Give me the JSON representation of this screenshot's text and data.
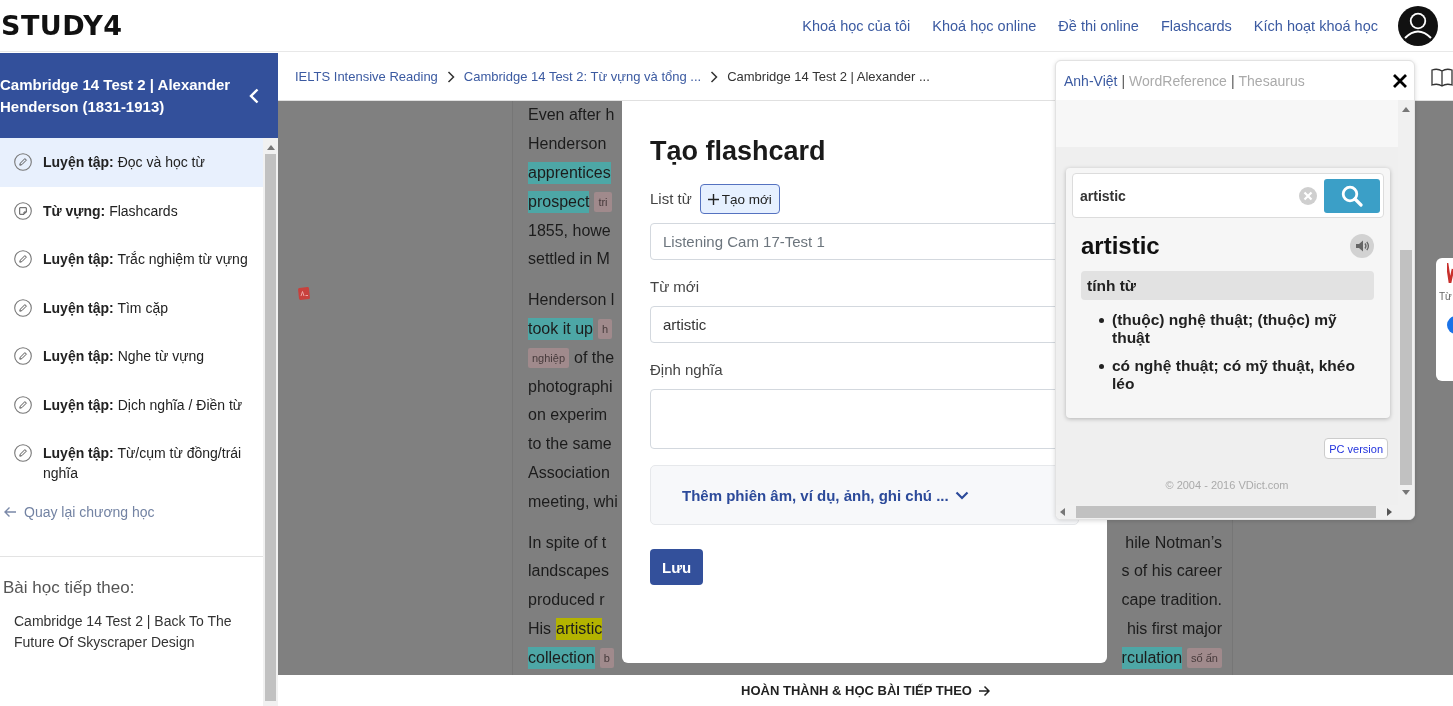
{
  "header": {
    "logo": "STUDY4",
    "nav": [
      {
        "label": "Khoá học của tôi"
      },
      {
        "label": "Khoá học online"
      },
      {
        "label": "Đề thi online"
      },
      {
        "label": "Flashcards"
      },
      {
        "label": "Kích hoạt khoá học"
      }
    ]
  },
  "sidebar": {
    "title": "Cambridge 14 Test 2 | Alexander Henderson (1831-1913)",
    "items": [
      {
        "kind": "exercise",
        "text": "**Luyện tập:** Đọc và học từ",
        "selected": true
      },
      {
        "kind": "flashcard",
        "text": "**Từ vựng:** Flashcards",
        "selected": false
      },
      {
        "kind": "exercise",
        "text": "**Luyện tập:** Trắc nghiệm từ vựng",
        "selected": false
      },
      {
        "kind": "exercise",
        "text": "**Luyện tập:** Tìm cặp",
        "selected": false
      },
      {
        "kind": "exercise",
        "text": "**Luyện tập:** Nghe từ vựng",
        "selected": false
      },
      {
        "kind": "exercise",
        "text": "**Luyện tập:** Dịch nghĩa / Điền từ",
        "selected": false
      },
      {
        "kind": "exercise",
        "text": "**Luyện tập:** Từ/cụm từ đồng/trái nghĩa",
        "selected": false
      }
    ],
    "back_link": "Quay lại chương học",
    "next_heading": "Bài học tiếp theo:",
    "next_lesson": "Cambridge 14 Test 2 | Back To The Future Of Skyscraper Design"
  },
  "breadcrumb": [
    {
      "label": "IELTS Intensive Reading",
      "current": false
    },
    {
      "label": "Cambridge 14 Test 2: Từ vựng và tổng ...",
      "current": false
    },
    {
      "label": "Cambridge 14 Test 2 | Alexander ...",
      "current": true
    }
  ],
  "article": {
    "paragraphs": [
      {
        "lines": [
          {
            "left": [
              {
                "kind": "text",
                "text": "Even after h"
              }
            ]
          },
          {
            "left": [
              {
                "kind": "text",
                "text": "Henderson"
              }
            ]
          },
          {
            "left": [
              {
                "kind": "vocab",
                "text": "apprentices"
              }
            ]
          },
          {
            "left": [
              {
                "kind": "vocab",
                "text": "prospect"
              },
              {
                "kind": "gloss",
                "text": "tri"
              }
            ]
          },
          {
            "left": [
              {
                "kind": "text",
                "text": "1855, howe"
              }
            ]
          },
          {
            "left": [
              {
                "kind": "text",
                "text": "settled in M"
              }
            ]
          }
        ]
      },
      {
        "lines": [
          {
            "left": [
              {
                "kind": "text",
                "text": "Henderson l"
              }
            ]
          },
          {
            "left": [
              {
                "kind": "vocab",
                "text": "took it up"
              },
              {
                "kind": "gloss",
                "text": "h"
              }
            ]
          },
          {
            "left": [
              {
                "kind": "gloss",
                "text": "nghiệp"
              },
              {
                "kind": "text",
                "text": "of the"
              }
            ]
          },
          {
            "left": [
              {
                "kind": "text",
                "text": "photographi"
              }
            ]
          },
          {
            "left": [
              {
                "kind": "text",
                "text": "on experim"
              }
            ]
          },
          {
            "left": [
              {
                "kind": "text",
                "text": "to the same"
              }
            ]
          },
          {
            "left": [
              {
                "kind": "text",
                "text": "Association"
              }
            ]
          },
          {
            "left": [
              {
                "kind": "text",
                "text": "meeting, whi"
              }
            ]
          }
        ]
      },
      {
        "lines": [
          {
            "left": [
              {
                "kind": "text",
                "text": "In spite of t"
              }
            ],
            "right": [
              {
                "kind": "text",
                "text": "hile Notman’s"
              }
            ]
          },
          {
            "left": [
              {
                "kind": "text",
                "text": "landscapes"
              }
            ],
            "right": [
              {
                "kind": "text",
                "text": "s of his career"
              }
            ]
          },
          {
            "left": [
              {
                "kind": "text",
                "text": "produced r"
              }
            ],
            "right": [
              {
                "kind": "text",
                "text": "cape tradition."
              }
            ]
          },
          {
            "left": [
              {
                "kind": "text",
                "text": "His"
              },
              {
                "kind": "current",
                "text": "artistic"
              }
            ],
            "right": [
              {
                "kind": "text",
                "text": "his first major"
              }
            ]
          },
          {
            "left": [
              {
                "kind": "vocab",
                "text": "collection"
              },
              {
                "kind": "gloss",
                "text": "b"
              }
            ],
            "right": [
              {
                "kind": "vocab",
                "text": "rculation"
              },
              {
                "kind": "gloss",
                "text": "số ấn"
              }
            ]
          }
        ]
      }
    ]
  },
  "modal": {
    "title": "Tạo flashcard",
    "list_label": "List từ",
    "new_list_button": "Tạo mới",
    "list_select": {
      "value": "Listening Cam 17-Test 1"
    },
    "word_label": "Từ mới",
    "word_input": {
      "value": "artistic"
    },
    "definition_label": "Định nghĩa",
    "more_toggle": {
      "label": "Thêm phiên âm, ví dụ, ảnh, ghi chú ...",
      "expanded": false
    },
    "save_button": "Lưu"
  },
  "dictionary": {
    "tabs": [
      {
        "label": "Anh-Việt",
        "selected": true
      },
      {
        "label": "WordReference",
        "selected": false
      },
      {
        "label": "Thesaurus",
        "selected": false
      }
    ],
    "tab_separators": [
      "|",
      "|"
    ],
    "search": {
      "value": "artistic"
    },
    "headword": "artistic",
    "part_of_speech": "tính từ",
    "senses": [
      "(thuộc) nghệ thuật; (thuộc) mỹ thuật",
      "có nghệ thuật; có mỹ thuật, khéo léo"
    ],
    "pc_version_button": "PC version",
    "copyright": "© 2004 - 2016 VDict.com"
  },
  "side_widget": {
    "label": "Từ"
  },
  "bottom_bar": {
    "next_button": "HOÀN THÀNH & HỌC BÀI TIẾP THEO"
  }
}
